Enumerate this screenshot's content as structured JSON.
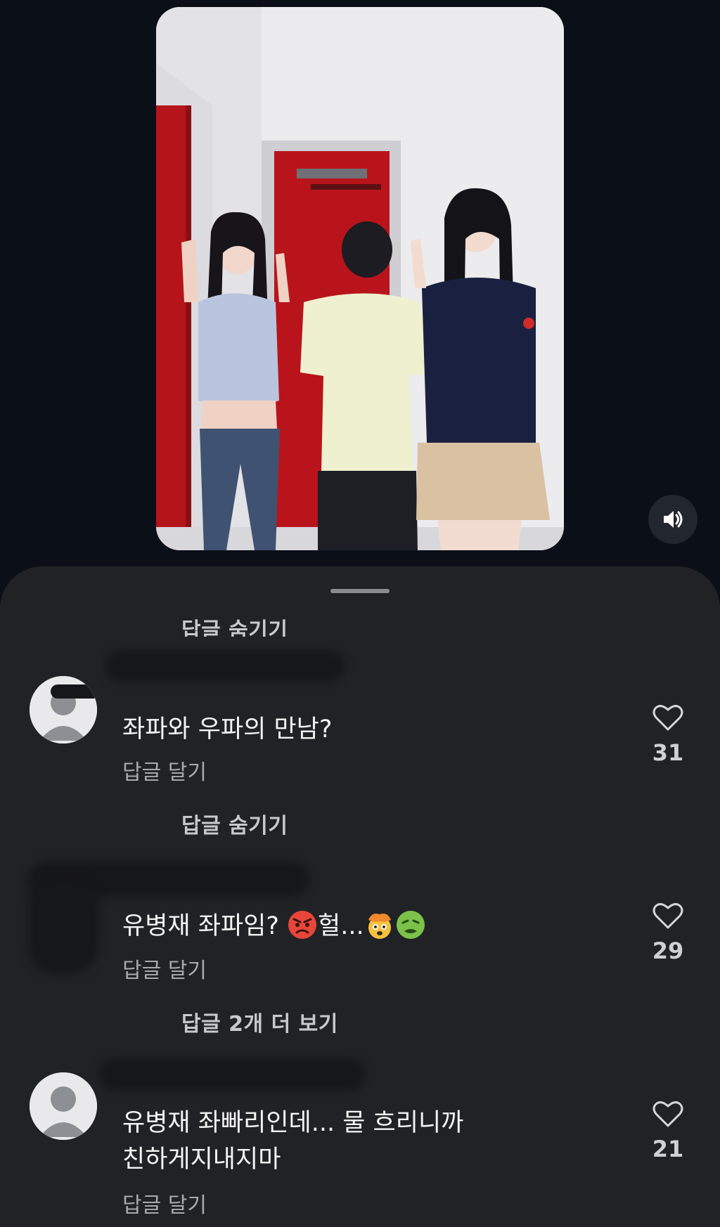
{
  "comments": [
    {
      "text": "좌파와 우파의 만남?",
      "reply_label": "답글 달기",
      "likes": "31"
    },
    {
      "text_prefix": "유병재 좌파임?",
      "text_mid": "헐...",
      "reply_label": "답글 달기",
      "likes": "29",
      "emojis": [
        "angry-face-emoji",
        "exploding-head-emoji",
        "nauseated-face-emoji"
      ]
    },
    {
      "text_line1": "유병재 좌빠리인데... 물 흐리니까",
      "text_line2": "친하게지내지마",
      "reply_label": "답글 달기",
      "likes": "21"
    }
  ],
  "thread_toggles": {
    "hide_replies_top": "답글 숨기기",
    "hide_replies": "답글 숨기기",
    "more_replies": "답글 2개 더 보기"
  },
  "colors": {
    "background": "#0b0f17",
    "sheet": "#212226",
    "text_primary": "#f4f4f4",
    "text_secondary": "#a9aaad"
  },
  "icons": [
    "volume-icon",
    "heart-icon",
    "default-avatar-icon"
  ]
}
